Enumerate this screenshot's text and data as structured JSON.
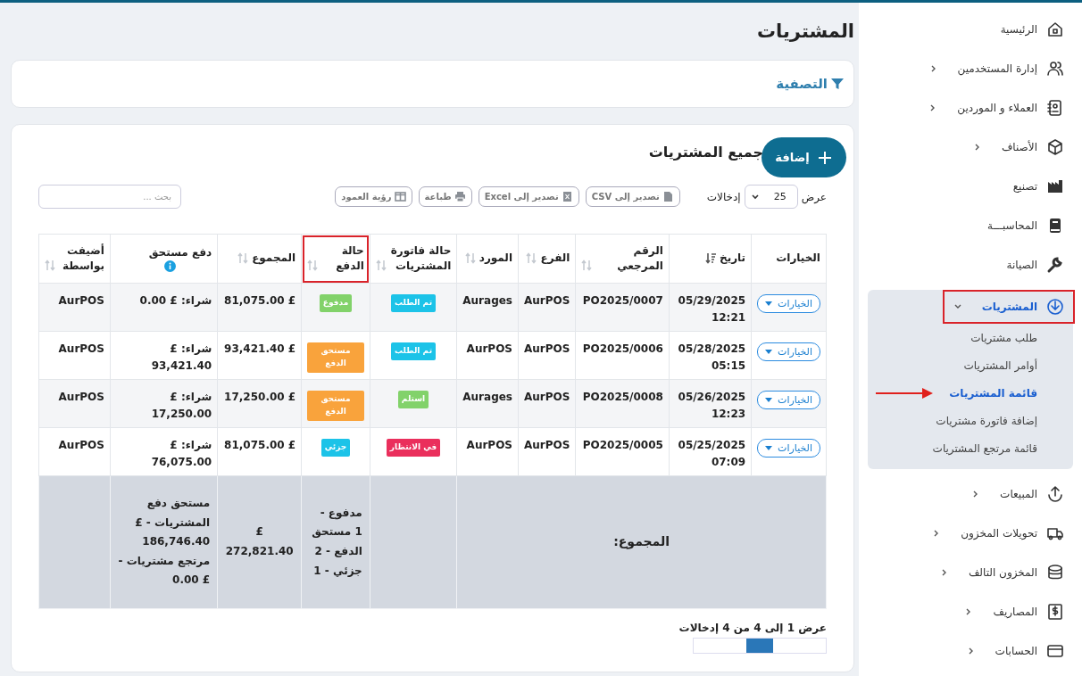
{
  "sidebar": {
    "items": [
      {
        "label": "الرئيسية",
        "has_children": false,
        "expanded": false,
        "selected": false,
        "highlighted": false
      },
      {
        "label": "إدارة المستخدمين",
        "has_children": true,
        "expanded": false,
        "selected": false,
        "highlighted": false
      },
      {
        "label": "العملاء و الموردين",
        "has_children": true,
        "expanded": false,
        "selected": false,
        "highlighted": false
      },
      {
        "label": "الأصناف",
        "has_children": true,
        "expanded": false,
        "selected": false,
        "highlighted": false
      },
      {
        "label": "تصنيع",
        "has_children": false,
        "expanded": false,
        "selected": false,
        "highlighted": false
      },
      {
        "label": "المحاسبـــة",
        "has_children": false,
        "expanded": false,
        "selected": false,
        "highlighted": false
      },
      {
        "label": "الصيانة",
        "has_children": false,
        "expanded": false,
        "selected": false,
        "highlighted": false
      },
      {
        "label": "المشتريات",
        "has_children": true,
        "expanded": true,
        "selected": true,
        "highlighted": true,
        "children": [
          {
            "label": "طلب مشتريات",
            "selected": false,
            "arrow": false
          },
          {
            "label": "أوامر المشتريات",
            "selected": false,
            "arrow": false
          },
          {
            "label": "قائمة المشتريات",
            "selected": true,
            "arrow": true
          },
          {
            "label": "إضافة فاتورة مشتريات",
            "selected": false,
            "arrow": false
          },
          {
            "label": "قائمة مرتجع المشتريات",
            "selected": false,
            "arrow": false
          }
        ]
      },
      {
        "label": "المبيعات",
        "has_children": true,
        "expanded": false,
        "selected": false,
        "highlighted": false
      },
      {
        "label": "تحويلات المخزون",
        "has_children": true,
        "expanded": false,
        "selected": false,
        "highlighted": false
      },
      {
        "label": "المخزون التالف",
        "has_children": true,
        "expanded": false,
        "selected": false,
        "highlighted": false
      },
      {
        "label": "المصاريف",
        "has_children": true,
        "expanded": false,
        "selected": false,
        "highlighted": false
      },
      {
        "label": "الحسابات",
        "has_children": true,
        "expanded": false,
        "selected": false,
        "highlighted": false
      }
    ]
  },
  "page_title": "المشتريات",
  "filter": {
    "label": "التصفية"
  },
  "purchases": {
    "title": "جميع المشتريات",
    "add_button": "إضافة",
    "length": {
      "prefix": "عرض",
      "value": "25",
      "suffix": "إدخالات"
    },
    "buttons": [
      {
        "label": "تصدير إلى CSV"
      },
      {
        "label": "تصدير إلى Excel"
      },
      {
        "label": "طباعة"
      },
      {
        "label": "رؤية العمود"
      }
    ],
    "search": {
      "placeholder": "بحث ..."
    },
    "table": {
      "columns": [
        {
          "label": "الخيارات",
          "kind": "plain",
          "info": false,
          "highlighted": false
        },
        {
          "label": "تاريخ",
          "kind": "sorted",
          "info": false,
          "highlighted": false
        },
        {
          "label": "الرقم المرجعي",
          "kind": "sortable",
          "info": false,
          "highlighted": false
        },
        {
          "label": "الفرع",
          "kind": "sortable",
          "info": false,
          "highlighted": false
        },
        {
          "label": "المورد",
          "kind": "sortable",
          "info": false,
          "highlighted": false
        },
        {
          "label": "حالة فاتورة المشتريات",
          "kind": "sortable",
          "info": false,
          "highlighted": false
        },
        {
          "label": "حالة الدفع",
          "kind": "sortable",
          "info": false,
          "highlighted": true
        },
        {
          "label": "المجموع",
          "kind": "sortable",
          "info": false,
          "highlighted": false
        },
        {
          "label": "دفع مستحق",
          "kind": "plain",
          "info": true,
          "highlighted": false
        },
        {
          "label": "أضيفت بواسطة",
          "kind": "sortable",
          "info": false,
          "highlighted": false
        }
      ],
      "rows": [
        {
          "options": "الخيارات",
          "date": "05/29/2025 12:21",
          "ref": "PO2025/0007",
          "branch": "AurPOS",
          "supplier": "Aurages",
          "invoice_status": {
            "label": "تم الطلب",
            "color": "#1cc3e8"
          },
          "payment_status": {
            "label": "مدفوع",
            "color": "#82d26a"
          },
          "total": "£ 81,075.00",
          "due": "شراء: £ 0.00",
          "added_by": "AurPOS"
        },
        {
          "options": "الخيارات",
          "date": "05/28/2025 05:15",
          "ref": "PO2025/0006",
          "branch": "AurPOS",
          "supplier": "AurPOS",
          "invoice_status": {
            "label": "تم الطلب",
            "color": "#1cc3e8"
          },
          "payment_status": {
            "label": "مستحق الدفع",
            "color": "#f9a33c"
          },
          "total": "£ 93,421.40",
          "due": "شراء: £ 93,421.40",
          "added_by": "AurPOS"
        },
        {
          "options": "الخيارات",
          "date": "05/26/2025 12:23",
          "ref": "PO2025/0008",
          "branch": "AurPOS",
          "supplier": "Aurages",
          "invoice_status": {
            "label": "استلم",
            "color": "#82d26a"
          },
          "payment_status": {
            "label": "مستحق الدفع",
            "color": "#f9a33c"
          },
          "total": "£ 17,250.00",
          "due": "شراء: £ 17,250.00",
          "added_by": "AurPOS"
        },
        {
          "options": "الخيارات",
          "date": "05/25/2025 07:09",
          "ref": "PO2025/0005",
          "branch": "AurPOS",
          "supplier": "AurPOS",
          "invoice_status": {
            "label": "في الانتظار",
            "color": "#ea2f5c"
          },
          "payment_status": {
            "label": "جزئي",
            "color": "#1cc3e8"
          },
          "total": "£ 81,075.00",
          "due": "شراء: £ 76,075.00",
          "added_by": "AurPOS"
        }
      ],
      "footer": {
        "label": "المجموع:",
        "payment_summary": "مدفوع - 1 مستحق الدفع - 2 جزئي - 1",
        "total": "£ 272,821.40",
        "due": "مستحق دفع المشتريات - £ 186,746.40 مرتجع مشتريات - £ 0.00"
      }
    },
    "info": "عرض 1 إلى 4 من 4 إدخالات"
  }
}
